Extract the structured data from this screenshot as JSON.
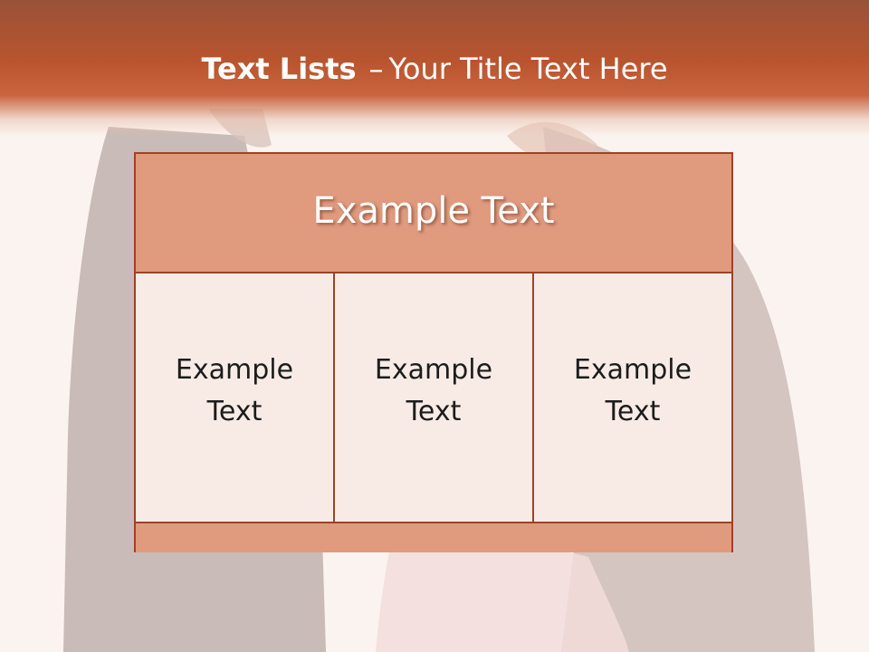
{
  "slide": {
    "title_strong": "Text Lists",
    "title_separator": "–",
    "title_sub": "Your Title Text Here",
    "table": {
      "header": "Example Text",
      "columns": [
        {
          "text": "Example Text"
        },
        {
          "text": "Example Text"
        },
        {
          "text": "Example Text"
        }
      ]
    }
  },
  "colors": {
    "header_band": "#b9542e",
    "box_border": "#9c4426",
    "box_fill": "#e09a7e",
    "cell_fill": "#f8ebe6"
  }
}
